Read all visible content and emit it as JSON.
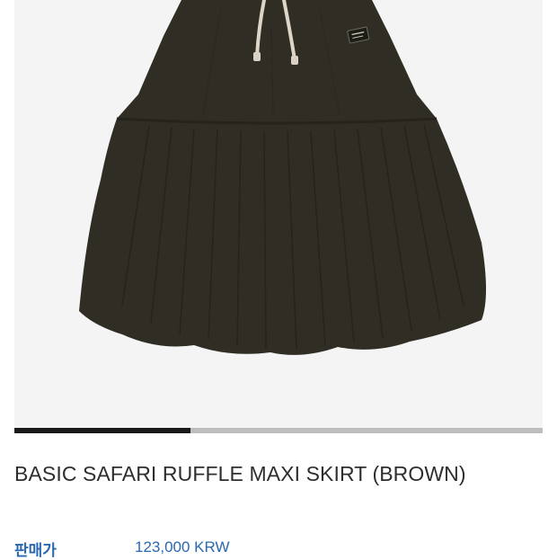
{
  "product": {
    "name": "BASIC SAFARI RUFFLE MAXI SKIRT (BROWN)",
    "image_icon": "skirt-photo",
    "price_label": "판매가",
    "price": "123,000 KRW"
  },
  "carousel": {
    "progress": 0.333
  },
  "colors": {
    "accent": "#2a69b0",
    "skirt": "#2f2d24",
    "background": "#f4f4f4",
    "carousel_active": "#1a1a1a",
    "carousel_track": "#bdbdbd"
  }
}
